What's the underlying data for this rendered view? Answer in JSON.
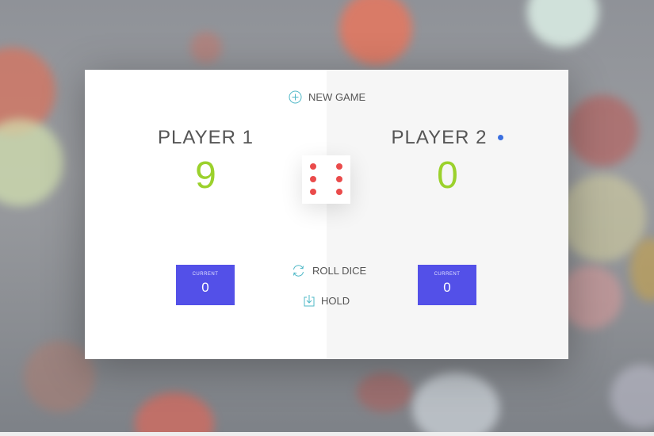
{
  "controls": {
    "new_game": {
      "label": "New game",
      "icon": "plus-circle-icon"
    },
    "roll_dice": {
      "label": "Roll dice",
      "icon": "refresh-icon"
    },
    "hold": {
      "label": "Hold",
      "icon": "download-icon"
    }
  },
  "players": [
    {
      "name": "Player 1",
      "score": "9",
      "current_label": "Current",
      "current_score": "0",
      "active": false
    },
    {
      "name": "Player 2",
      "score": "0",
      "current_label": "Current",
      "current_score": "0",
      "active": true
    }
  ],
  "dice": {
    "value": 6
  },
  "colors": {
    "score": "#9bd12c",
    "current_box": "#5350e8",
    "dice_pip": "#ea4b4b",
    "active_indicator": "#3b6fe0",
    "icon": "#4fb8c7"
  }
}
